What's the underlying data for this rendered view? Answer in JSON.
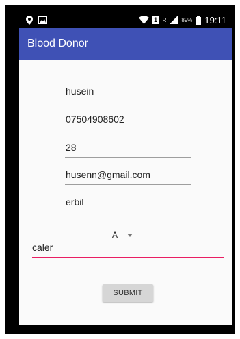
{
  "status_bar": {
    "network_label": "1",
    "signal_label": "R",
    "battery_percent": "89%",
    "time": "19:11",
    "icons": [
      "location-icon",
      "image-icon",
      "wifi-icon",
      "sim-icon",
      "signal-icon",
      "battery-icon"
    ]
  },
  "app_bar": {
    "title": "Blood Donor",
    "color": "#3f51b5"
  },
  "form": {
    "name": "husein",
    "phone": "07504908602",
    "age": "28",
    "email": "husenn@gmail.com",
    "city": "erbil",
    "blood_type": "A",
    "address": "caler",
    "submit_label": "SUBMIT"
  },
  "colors": {
    "accent": "#e91e63",
    "button_bg": "#d6d6d6"
  }
}
